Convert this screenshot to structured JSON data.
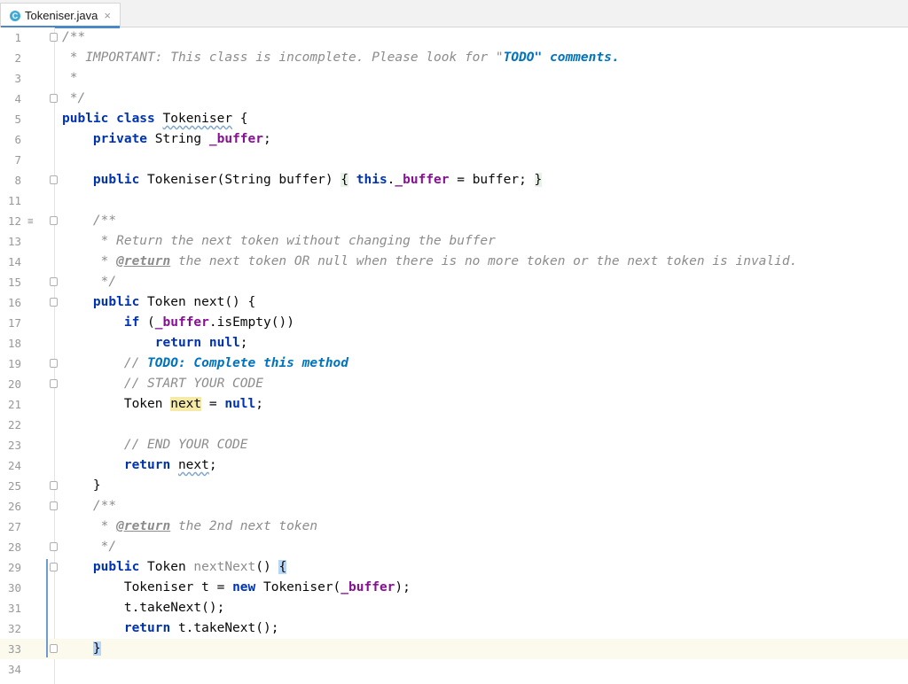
{
  "tab": {
    "icon_letter": "C",
    "filename": "Tokeniser.java",
    "close_glyph": "×"
  },
  "code_lines": [
    {
      "n": "1",
      "parts": [
        [
          "cm",
          "/**"
        ]
      ],
      "fold": true
    },
    {
      "n": "2",
      "parts": [
        [
          "doc",
          " * IMPORTANT: This class is incomplete. Please look for \""
        ],
        [
          "todo",
          "TODO"
        ],
        [
          "todo",
          "\" comments."
        ]
      ]
    },
    {
      "n": "3",
      "parts": [
        [
          "doc",
          " *"
        ]
      ]
    },
    {
      "n": "4",
      "parts": [
        [
          "doc",
          " */"
        ]
      ],
      "fold": true
    },
    {
      "n": "5",
      "parts": [
        [
          "kw",
          "public class "
        ],
        [
          "wavy",
          "Tokeniser"
        ],
        [
          "",
          " {"
        ]
      ]
    },
    {
      "n": "6",
      "parts": [
        [
          "",
          "    "
        ],
        [
          "kw",
          "private "
        ],
        [
          "",
          "String "
        ],
        [
          "fld",
          "_buffer"
        ],
        [
          "",
          ";"
        ]
      ]
    },
    {
      "n": "7",
      "parts": []
    },
    {
      "n": "8",
      "parts": [
        [
          "",
          "    "
        ],
        [
          "kw",
          "public "
        ],
        [
          "",
          "Tokeniser(String buffer) "
        ],
        [
          "brace",
          "{"
        ],
        [
          "",
          " "
        ],
        [
          "kw",
          "this"
        ],
        [
          "",
          "."
        ],
        [
          "fld",
          "_buffer"
        ],
        [
          "",
          " = buffer; "
        ],
        [
          "brace",
          "}"
        ]
      ],
      "fold": true
    },
    {
      "n": "11",
      "parts": []
    },
    {
      "n": "12",
      "parts": [
        [
          "",
          "    "
        ],
        [
          "cm",
          "/**"
        ]
      ],
      "fold": true,
      "marker": true
    },
    {
      "n": "13",
      "parts": [
        [
          "doc",
          "     * Return the next token without changing the buffer"
        ]
      ]
    },
    {
      "n": "14",
      "parts": [
        [
          "doc",
          "     * "
        ],
        [
          "tag",
          "@return"
        ],
        [
          "doc",
          " the next token OR null when there is no more token or the next token is invalid."
        ]
      ]
    },
    {
      "n": "15",
      "parts": [
        [
          "doc",
          "     */"
        ]
      ],
      "fold": true
    },
    {
      "n": "16",
      "parts": [
        [
          "",
          "    "
        ],
        [
          "kw",
          "public "
        ],
        [
          "",
          "Token next() {"
        ]
      ],
      "fold": true
    },
    {
      "n": "17",
      "parts": [
        [
          "",
          "        "
        ],
        [
          "kw",
          "if "
        ],
        [
          "",
          "("
        ],
        [
          "fld",
          "_buffer"
        ],
        [
          "",
          ".isEmpty())"
        ]
      ]
    },
    {
      "n": "18",
      "parts": [
        [
          "",
          "            "
        ],
        [
          "kw",
          "return null"
        ],
        [
          "",
          ";"
        ]
      ]
    },
    {
      "n": "19",
      "parts": [
        [
          "",
          "        "
        ],
        [
          "cm",
          "// "
        ],
        [
          "todo",
          "TODO: Complete this method"
        ]
      ],
      "fold": true
    },
    {
      "n": "20",
      "parts": [
        [
          "",
          "        "
        ],
        [
          "cm",
          "// START YOUR CODE"
        ]
      ],
      "fold": true
    },
    {
      "n": "21",
      "parts": [
        [
          "",
          "        Token "
        ],
        [
          "hl",
          "next"
        ],
        [
          "",
          " = "
        ],
        [
          "kw",
          "null"
        ],
        [
          "",
          ";"
        ]
      ]
    },
    {
      "n": "22",
      "parts": []
    },
    {
      "n": "23",
      "parts": [
        [
          "",
          "        "
        ],
        [
          "cm",
          "// END YOUR CODE"
        ]
      ]
    },
    {
      "n": "24",
      "parts": [
        [
          "",
          "        "
        ],
        [
          "kw",
          "return "
        ],
        [
          "wavy",
          "next"
        ],
        [
          "",
          ";"
        ]
      ]
    },
    {
      "n": "25",
      "parts": [
        [
          "",
          "    }"
        ]
      ],
      "fold": true
    },
    {
      "n": "26",
      "parts": [
        [
          "",
          "    "
        ],
        [
          "cm",
          "/**"
        ]
      ],
      "fold": true
    },
    {
      "n": "27",
      "parts": [
        [
          "doc",
          "     * "
        ],
        [
          "tag",
          "@return"
        ],
        [
          "doc",
          " the 2nd next token"
        ]
      ]
    },
    {
      "n": "28",
      "parts": [
        [
          "doc",
          "     */"
        ]
      ],
      "fold": true
    },
    {
      "n": "29",
      "parts": [
        [
          "",
          "    "
        ],
        [
          "kw",
          "public "
        ],
        [
          "",
          "Token "
        ],
        [
          "unused",
          "nextNext"
        ],
        [
          "",
          "() "
        ],
        [
          "brace2",
          "{"
        ]
      ],
      "fold": true
    },
    {
      "n": "30",
      "parts": [
        [
          "",
          "        Tokeniser t = "
        ],
        [
          "kw",
          "new "
        ],
        [
          "",
          "Tokeniser("
        ],
        [
          "fld",
          "_buffer"
        ],
        [
          "",
          ");"
        ]
      ]
    },
    {
      "n": "31",
      "parts": [
        [
          "",
          "        t.takeNext();"
        ]
      ]
    },
    {
      "n": "32",
      "parts": [
        [
          "",
          "        "
        ],
        [
          "kw",
          "return "
        ],
        [
          "",
          "t.takeNext();"
        ]
      ]
    },
    {
      "n": "33",
      "parts": [
        [
          "",
          "    "
        ],
        [
          "brace2",
          "}"
        ]
      ],
      "fold": true,
      "current": true
    },
    {
      "n": "34",
      "parts": []
    }
  ]
}
